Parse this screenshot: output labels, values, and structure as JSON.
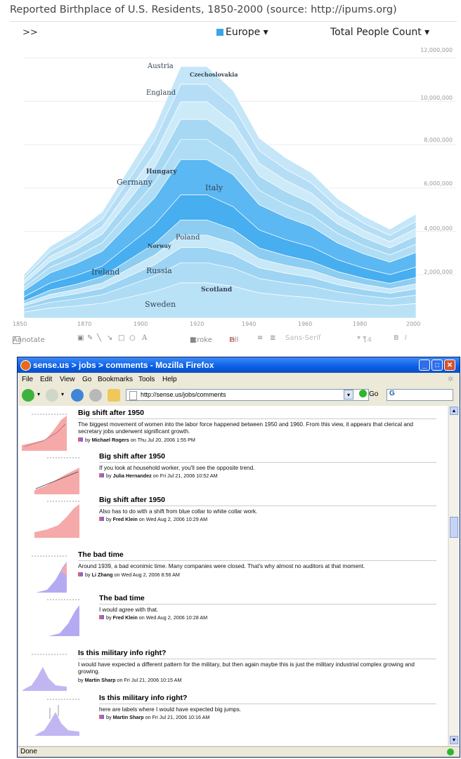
{
  "page_title": "Reported Birthplace of U.S. Residents, 1850-2000 (source: http://ipums.org)",
  "viz": {
    "toggle_label": ">>",
    "region_selector": "Europe",
    "measure_selector": "Total People Count",
    "region_color": "#3aa5e8",
    "y_ticks": [
      "12,000,000",
      "10,000,000",
      "8,000,000",
      "6,000,000",
      "4,000,000",
      "2,000,000"
    ],
    "x_ticks": [
      "1850",
      "1870",
      "1900",
      "1920",
      "1940",
      "1960",
      "1980",
      "2000"
    ],
    "stream_labels": [
      "Austria",
      "Czechoslovakia",
      "England",
      "Hungary",
      "Germany",
      "Italy",
      "Poland",
      "Norway",
      "Ireland",
      "Russia",
      "Scotland",
      "Sweden"
    ],
    "toolbar": {
      "annotate": "Annotate",
      "stroke": "Stroke",
      "fill": "Fill",
      "font": "Sans-Serif",
      "size": "14",
      "bold": "B",
      "italic": "I",
      "text_tool": "A"
    }
  },
  "chart_data": {
    "type": "area",
    "title": "Reported Birthplace of U.S. Residents, 1850-2000 (source: http://ipums.org)",
    "x": [
      1850,
      1860,
      1870,
      1880,
      1900,
      1910,
      1920,
      1930,
      1940,
      1950,
      1960,
      1970,
      1980,
      1990,
      2000
    ],
    "series": [
      {
        "name": "Europe",
        "values": [
          2000000,
          3300000,
          4000000,
          4900000,
          8800000,
          11600000,
          11600000,
          10500000,
          8300000,
          7400000,
          6700000,
          5500000,
          4700000,
          4100000,
          4800000
        ]
      }
    ],
    "ylim": [
      0,
      12500000
    ],
    "grid": true,
    "xlabel": "",
    "ylabel": ""
  },
  "browser": {
    "title": "sense.us > jobs > comments - Mozilla Firefox",
    "menu": [
      "File",
      "Edit",
      "View",
      "Go",
      "Bookmarks",
      "Tools",
      "Help"
    ],
    "url": "http://sense.us/jobs/comments",
    "go_label": "Go",
    "search_logo": "G",
    "status": "Done"
  },
  "comments": [
    {
      "title": "Big shift after 1950",
      "body": "The biggest movement of women into the labor force happened between 1950 and 1960. From this view, it appears that clerical and secretary jobs underwent significant growth.",
      "by": "by",
      "author": "Michael Rogers",
      "date": "on Thu Jul 20, 2006 1:55 PM"
    },
    {
      "title": "Big shift after 1950",
      "body": "If you look at household worker, you'll see the opposite trend.",
      "by": "by",
      "author": "Julia Hernandez",
      "date": "on Fri Jul 21, 2006 10:52 AM"
    },
    {
      "title": "Big shift after 1950",
      "body": "Also has to do with a shift from blue collar to white collar work.",
      "by": "by",
      "author": "Fred Klein",
      "date": "on Wed Aug 2, 2006 10:29 AM"
    },
    {
      "title": "The bad time",
      "body": "Around 1939, a bad econimic time. Many companies were closed. That's why almost no auditors at that moment.",
      "by": "by",
      "author": "Li Zhang",
      "date": "on Wed Aug 2, 2006 8:56 AM"
    },
    {
      "title": "The bad time",
      "body": "I would agree with that.",
      "by": "by",
      "author": "Fred Klein",
      "date": "on Wed Aug 2, 2006 10:28 AM"
    },
    {
      "title": "Is this military info right?",
      "body": "I would have expected a different pattern for the military, but then again maybe this is just the military industrial complex growing and growing.",
      "by": "by",
      "author": "Martin Sharp",
      "date": "on Fri Jul 21, 2006 10:15 AM"
    },
    {
      "title": "Is this military info right?",
      "body": "here are labels where I would have expected big jumps.",
      "by": "by",
      "author": "Martin Sharp",
      "date": "on Fri Jul 21, 2006 10:16 AM"
    }
  ]
}
